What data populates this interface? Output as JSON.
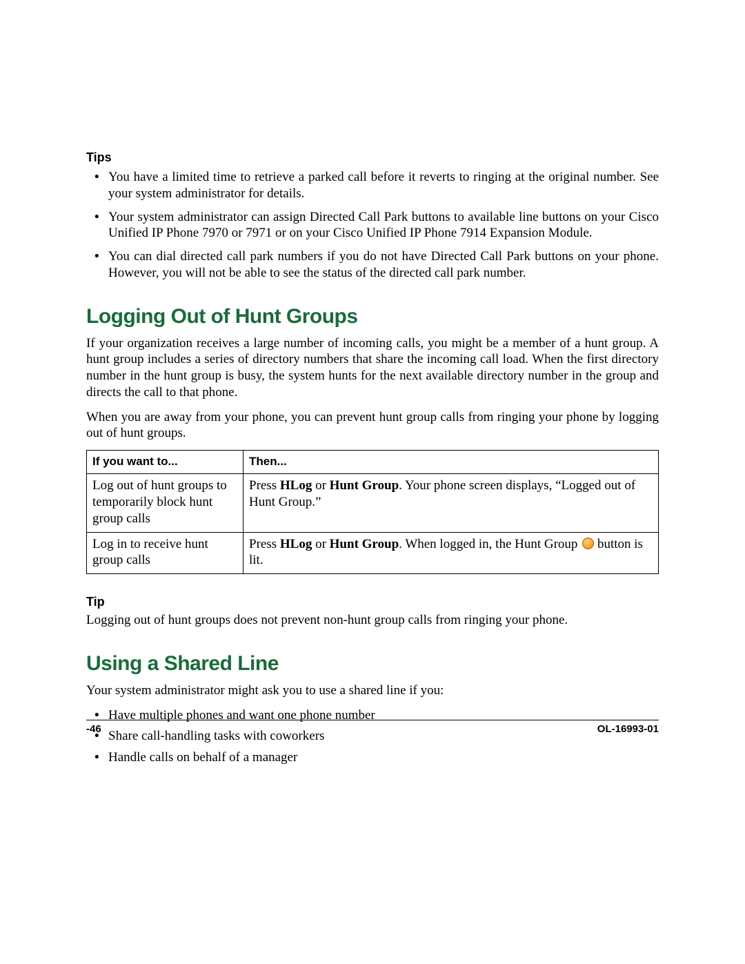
{
  "tips_section": {
    "label": "Tips",
    "items": [
      "You have a limited time to retrieve a parked call before it reverts to ringing at the original number. See your system administrator for details.",
      "Your system administrator can assign Directed Call Park buttons to available line buttons on your Cisco Unified IP Phone 7970 or 7971 or on your Cisco Unified IP Phone 7914 Expansion Module.",
      "You can dial directed call park numbers if you do not have Directed Call Park buttons on your phone. However, you will not be able to see the status of the directed call park number."
    ]
  },
  "hunt_section": {
    "heading": "Logging Out of Hunt Groups",
    "para1": "If your organization receives a large number of incoming calls, you might be a member of a hunt group. A hunt group includes a series of directory numbers that share the incoming call load. When the first directory number in the hunt group is busy, the system hunts for the next available directory number in the group and directs the call to that phone.",
    "para2": "When you are away from your phone, you can prevent hunt group calls from ringing your phone by logging out of hunt groups.",
    "table": {
      "headers": [
        "If you want to...",
        "Then..."
      ],
      "rows": [
        {
          "want": "Log out of hunt groups to temporarily block hunt group calls",
          "then_pre": "Press ",
          "then_b1": "HLog",
          "then_mid": " or ",
          "then_b2": "Hunt Group",
          "then_post": ". Your phone screen displays, “Logged out of Hunt Group.”",
          "has_dot": false
        },
        {
          "want": "Log in to receive hunt group calls",
          "then_pre": "Press ",
          "then_b1": "HLog",
          "then_mid": " or ",
          "then_b2": "Hunt Group",
          "then_post": ". When logged in, the Hunt Group ",
          "then_post2": " button is lit.",
          "has_dot": true
        }
      ]
    },
    "tip_label": "Tip",
    "tip_text": "Logging out of hunt groups does not prevent non-hunt group calls from ringing your phone."
  },
  "shared_section": {
    "heading": "Using a Shared Line",
    "intro": "Your system administrator might ask you to use a shared line if you:",
    "items": [
      "Have multiple phones and want one phone number",
      "Share call-handling tasks with coworkers",
      "Handle calls on behalf of a manager"
    ]
  },
  "footer": {
    "page": "-46",
    "doc": "OL-16993-01"
  }
}
